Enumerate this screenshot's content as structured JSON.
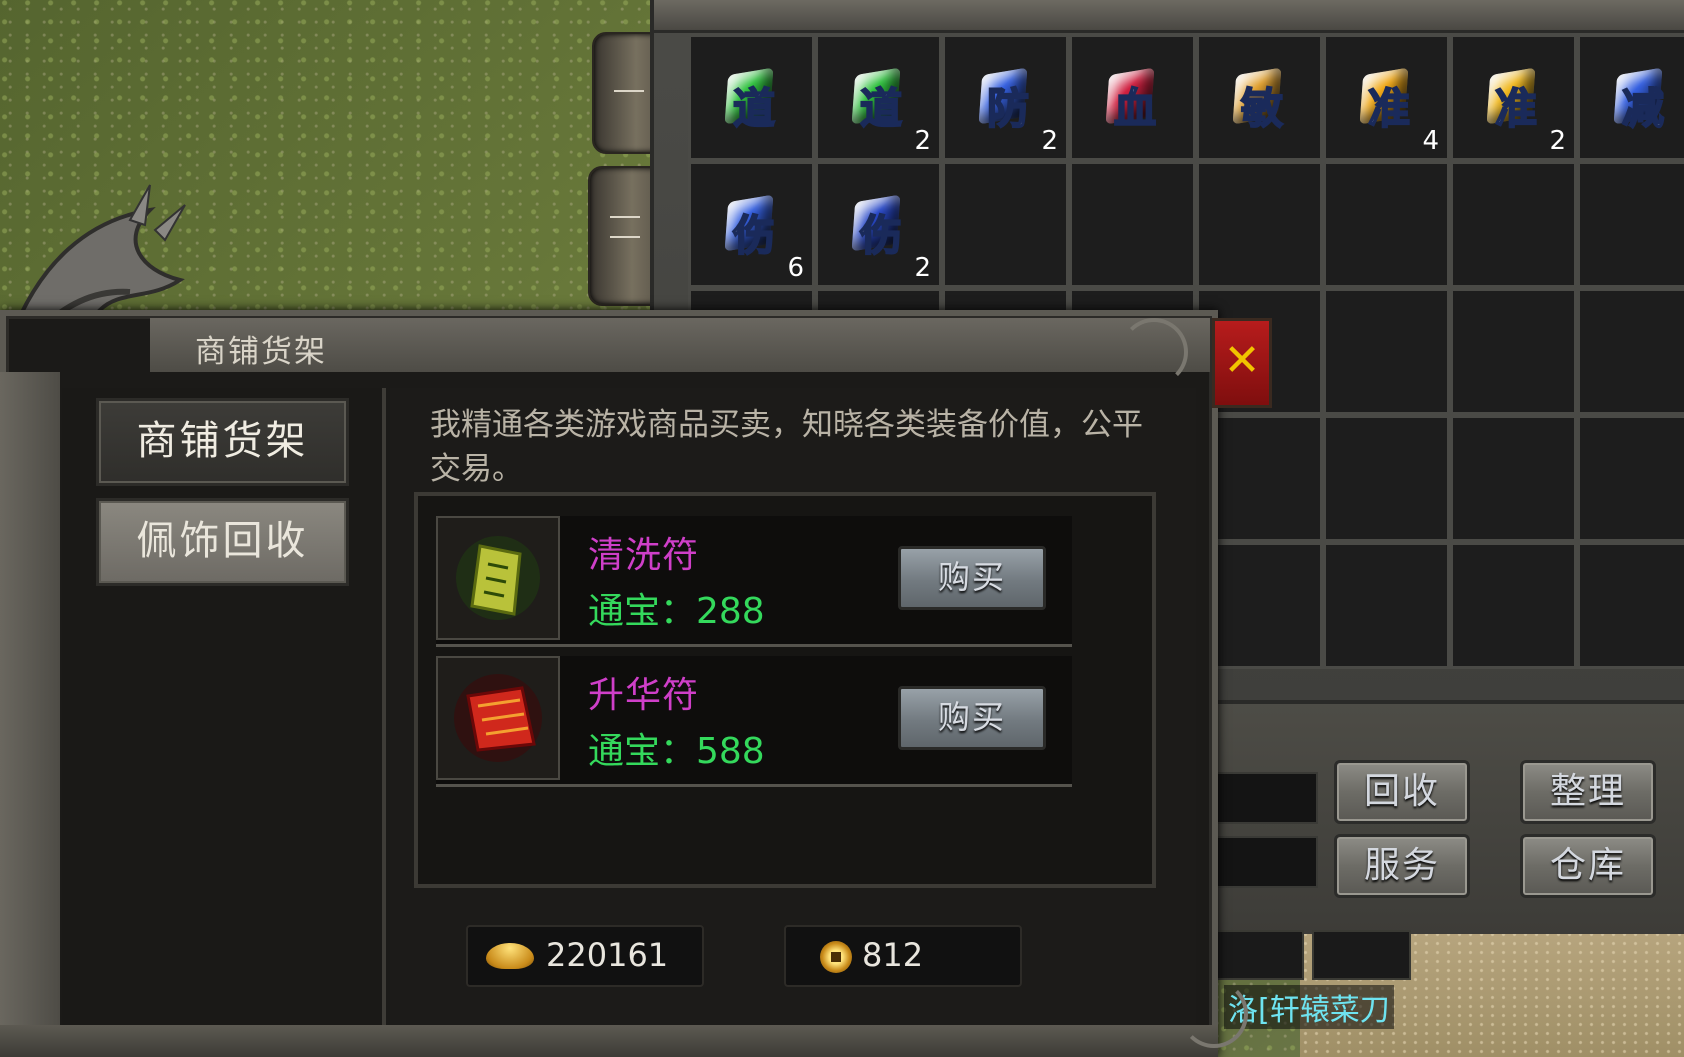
{
  "inventory": {
    "cells": [
      {
        "char": "道",
        "count": "",
        "color": "#2fc13e"
      },
      {
        "char": "道",
        "count": "2",
        "color": "#2fc13e"
      },
      {
        "char": "防",
        "count": "2",
        "color": "#3560e0"
      },
      {
        "char": "血",
        "count": "",
        "color": "#d02040"
      },
      {
        "char": "敏",
        "count": "",
        "color": "#e0a030"
      },
      {
        "char": "准",
        "count": "4",
        "color": "#f0a818"
      },
      {
        "char": "准",
        "count": "2",
        "color": "#f0b820"
      },
      {
        "char": "减",
        "count": "",
        "color": "#3560e0"
      },
      {
        "char": "伤",
        "count": "6",
        "color": "#3560e0"
      },
      {
        "char": "伤",
        "count": "2",
        "color": "#2848c8"
      }
    ],
    "buttons": {
      "recycle": "回收",
      "sort": "整理",
      "service": "服务",
      "warehouse": "仓库"
    },
    "close_symbol": "✕",
    "equip_name": "洛[轩辕菜刀"
  },
  "shop": {
    "title": "商铺货架",
    "tabs": {
      "shelf": "商铺货架",
      "accessory_recycle": "佩饰回收"
    },
    "description": "我精通各类游戏商品买卖，知晓各类装备价值，公平交易。",
    "items": [
      {
        "name": "清洗符",
        "price": "通宝：288",
        "buy": "购买"
      },
      {
        "name": "升华符",
        "price": "通宝：588",
        "buy": "购买"
      }
    ],
    "currency": {
      "gold": "220161",
      "coins": "812"
    }
  },
  "side_tabs": {
    "tab1": "—",
    "tab2": "二"
  }
}
